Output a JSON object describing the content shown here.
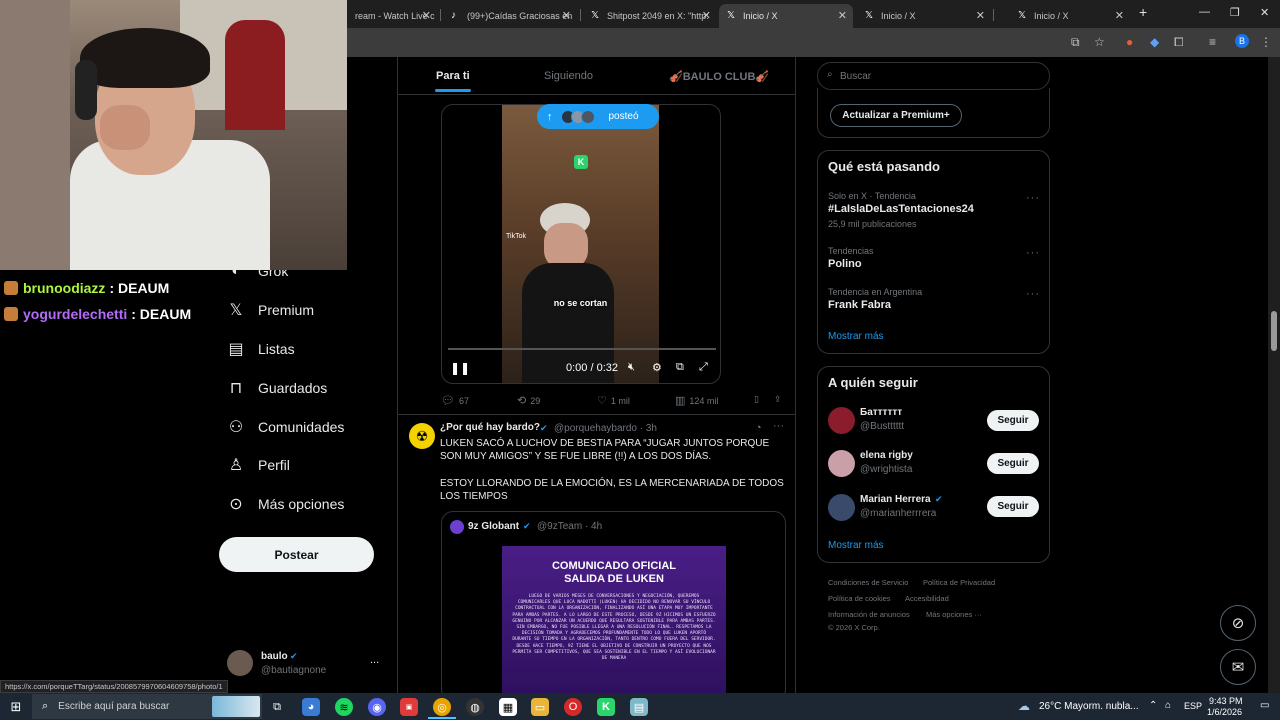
{
  "browser": {
    "tabs": [
      {
        "title": "ream - Watch Live c",
        "icon": "twitch-icon"
      },
      {
        "title": "(99+)Caídas Graciosas en",
        "icon": "tiktok-icon"
      },
      {
        "title": "Shitpost 2049 en X: \"http:",
        "icon": "x-logo-icon"
      },
      {
        "title": "Inicio / X",
        "icon": "x-logo-icon"
      },
      {
        "title": "Inicio / X",
        "icon": "x-logo-icon"
      },
      {
        "title": "Inicio / X",
        "icon": "x-logo-icon"
      }
    ],
    "new_tab": "+",
    "profile_initial": "B",
    "status_url": "https://x.com/porqueTTarg/status/2008579970604609758/photo/1"
  },
  "chat": [
    {
      "user": "brunoodiazz",
      "message": ": DEAUM",
      "color": "#adf63e"
    },
    {
      "user": "yogurdelechetti",
      "message": ": DEAUM",
      "color": "#b36cf7"
    }
  ],
  "nav": {
    "grok": "Grok",
    "premium": "Premium",
    "listas": "Listas",
    "guardados": "Guardados",
    "comunidades": "Comunidades",
    "perfil": "Perfil",
    "mas": "Más opciones",
    "post_button": "Postear",
    "account_name": "baulo",
    "account_handle": "@bautiagnone",
    "account_more": "..."
  },
  "feed": {
    "tabs": [
      "Para ti",
      "Siguiendo",
      "🎻BAULO CLUB🎻"
    ],
    "posted_pill": "posteó",
    "video": {
      "caption": "no se cortan",
      "time": "0:00 / 0:32",
      "watermark": "TikTok"
    },
    "actions": {
      "replies": "67",
      "reposts": "29",
      "likes": "1 mil",
      "views": "124 mil"
    },
    "tweet2": {
      "name": "¿Por qué hay bardo?",
      "handle": "@porquehaybardo · 3h",
      "text1": "LUKEN SACÓ A LUCHOV DE BESTIA PARA “JUGAR JUNTOS PORQUE SON MUY AMIGOS” Y SE FUE LIBRE (!!) A LOS DOS DÍAS.",
      "text2": "ESTOY LLORANDO DE LA EMOCIÓN, ES LA MERCENARIADA DE TODOS LOS TIEMPOS",
      "quote_name": "9z Globant",
      "quote_handle": "@9zTeam · 4h",
      "image_title": "COMUNICADO OFICIAL\nSALIDA DE LUKEN",
      "image_body": "LUEGO DE VARIOS MESES DE CONVERSACIONES Y NEGOCIACIÓN, QUEREMOS COMUNICARLES QUE LUCA NADOTTI (LUKEN) HA DECIDIDO NO RENOVAR SU VÍNCULO CONTRACTUAL CON LA ORGANIZACIÓN, FINALIZANDO ASÍ UNA ETAPA MUY IMPORTANTE PARA AMBAS PARTES. A LO LARGO DE ESTE PROCESO, DESDE 9Z HICIMOS UN ESFUERZO GENUINO POR ALCANZAR UN ACUERDO QUE RESULTARA SOSTENIBLE PARA AMBAS PARTES. SIN EMBARGO, NO FUE POSIBLE LLEGAR A UNA RESOLUCIÓN FINAL. RESPETAMOS LA DECISIÓN TOMADA Y AGRADECEMOS PROFUNDAMENTE TODO LO QUE LUKEN APORTÓ DURANTE SU TIEMPO EN LA ORGANIZACIÓN, TANTO DENTRO COMO FUERA DEL SERVIDOR. DESDE HACE TIEMPO, 9Z TIENE EL OBJETIVO DE CONSTRUIR UN PROYECTO QUE NOS PERMITA SER COMPETITIVOS, QUE SEA SOSTENIBLE EN EL TIEMPO Y ASÍ EVOLUCIONAR DE MANERA"
    }
  },
  "sidebar": {
    "search_placeholder": "Buscar",
    "premium_button": "Actualizar a Premium+",
    "trending_title": "Qué está pasando",
    "trends": [
      {
        "meta": "Solo en X · Tendencia",
        "name": "#LaIslaDeLasTentaciones24",
        "count": "25,9 mil publicaciones"
      },
      {
        "meta": "Tendencias",
        "name": "Polino",
        "count": ""
      },
      {
        "meta": "Tendencia en Argentina",
        "name": "Frank Fabra",
        "count": ""
      }
    ],
    "show_more": "Mostrar más",
    "who_title": "A quién seguir",
    "who": [
      {
        "name": "Батттттт",
        "handle": "@Bustttttt",
        "color": "#8a1c2b"
      },
      {
        "name": "elena rigby",
        "handle": "@wrightista",
        "color": "#c9a0a8"
      },
      {
        "name": "Marian Herrera",
        "handle": "@marianherrrera",
        "color": "#3a4a6b"
      }
    ],
    "follow_label": "Seguir",
    "who_more": "Mostrar más",
    "footer": [
      "Condiciones de Servicio",
      "Política de Privacidad",
      "Política de cookies",
      "Accesibilidad",
      "Información de anuncios",
      "Más opciones ···",
      "© 2026 X Corp."
    ]
  },
  "taskbar": {
    "search_placeholder": "Escribe aquí para buscar",
    "weather": "26°C  Mayorm. nubla...",
    "lang": "ESP",
    "time": "9:43 PM",
    "date": "1/6/2026"
  }
}
